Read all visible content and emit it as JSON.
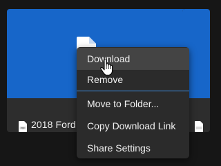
{
  "cards": [
    {
      "file_name": "2018 Ford",
      "file_type_icon": "pdf-file-icon",
      "thumbnail_icon": "document-icon",
      "accent": "#1766c9"
    },
    {
      "file_name": "",
      "file_type_icon": "pdf-file-icon",
      "accent": "#1766c9"
    }
  ],
  "context_menu": {
    "items": [
      {
        "label": "Download",
        "hovered": true
      },
      {
        "label": "Remove"
      },
      {
        "label": "Move to Folder..."
      },
      {
        "label": "Copy Download Link"
      },
      {
        "label": "Share Settings"
      }
    ]
  },
  "cursor": "hand-pointer-icon"
}
